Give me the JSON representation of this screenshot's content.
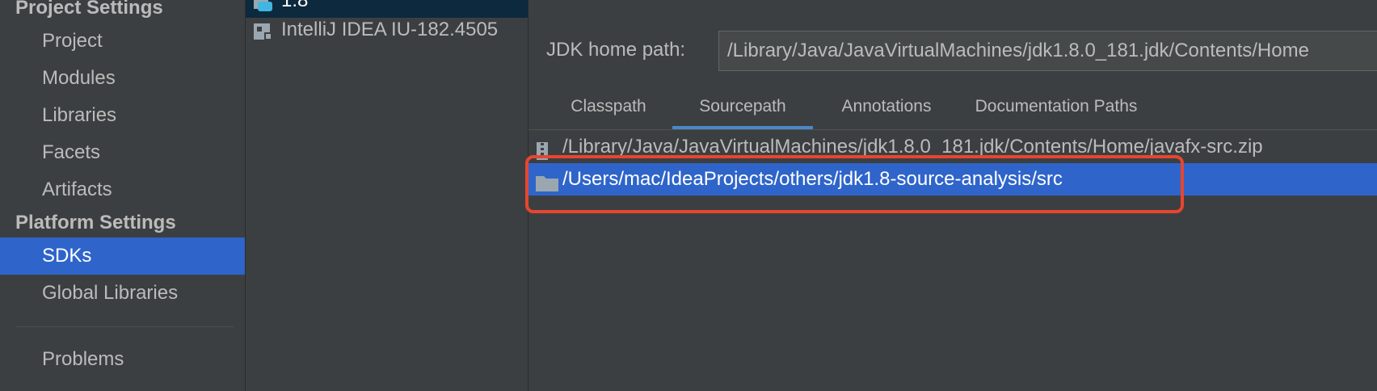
{
  "sidebar": {
    "project_settings_header": "Project Settings",
    "project_items": [
      "Project",
      "Modules",
      "Libraries",
      "Facets",
      "Artifacts"
    ],
    "platform_settings_header": "Platform Settings",
    "platform_items": [
      "SDKs",
      "Global Libraries"
    ],
    "selected": "SDKs",
    "problems": "Problems"
  },
  "sdk_list": {
    "items": [
      {
        "label": "1.8",
        "icon": "java-sdk-icon",
        "selected": true
      },
      {
        "label": "IntelliJ IDEA IU-182.4505",
        "icon": "intellij-sdk-icon",
        "selected": false
      }
    ]
  },
  "detail": {
    "jdk_home_label": "JDK home path:",
    "jdk_home_value": "/Library/Java/JavaVirtualMachines/jdk1.8.0_181.jdk/Contents/Home",
    "tabs": [
      "Classpath",
      "Sourcepath",
      "Annotations",
      "Documentation Paths"
    ],
    "active_tab": "Sourcepath",
    "paths": [
      {
        "label": "/Library/Java/JavaVirtualMachines/jdk1.8.0_181.jdk/Contents/Home/javafx-src.zip",
        "icon": "zip-archive-icon",
        "selected": false
      },
      {
        "label": "/Users/mac/IdeaProjects/others/jdk1.8-source-analysis/src",
        "icon": "folder-icon",
        "selected": true
      }
    ]
  },
  "colors": {
    "background": "#3c3f41",
    "selection": "#2f65ca",
    "tab_underline": "#4a88c7",
    "annotation_box": "#e8452f"
  }
}
